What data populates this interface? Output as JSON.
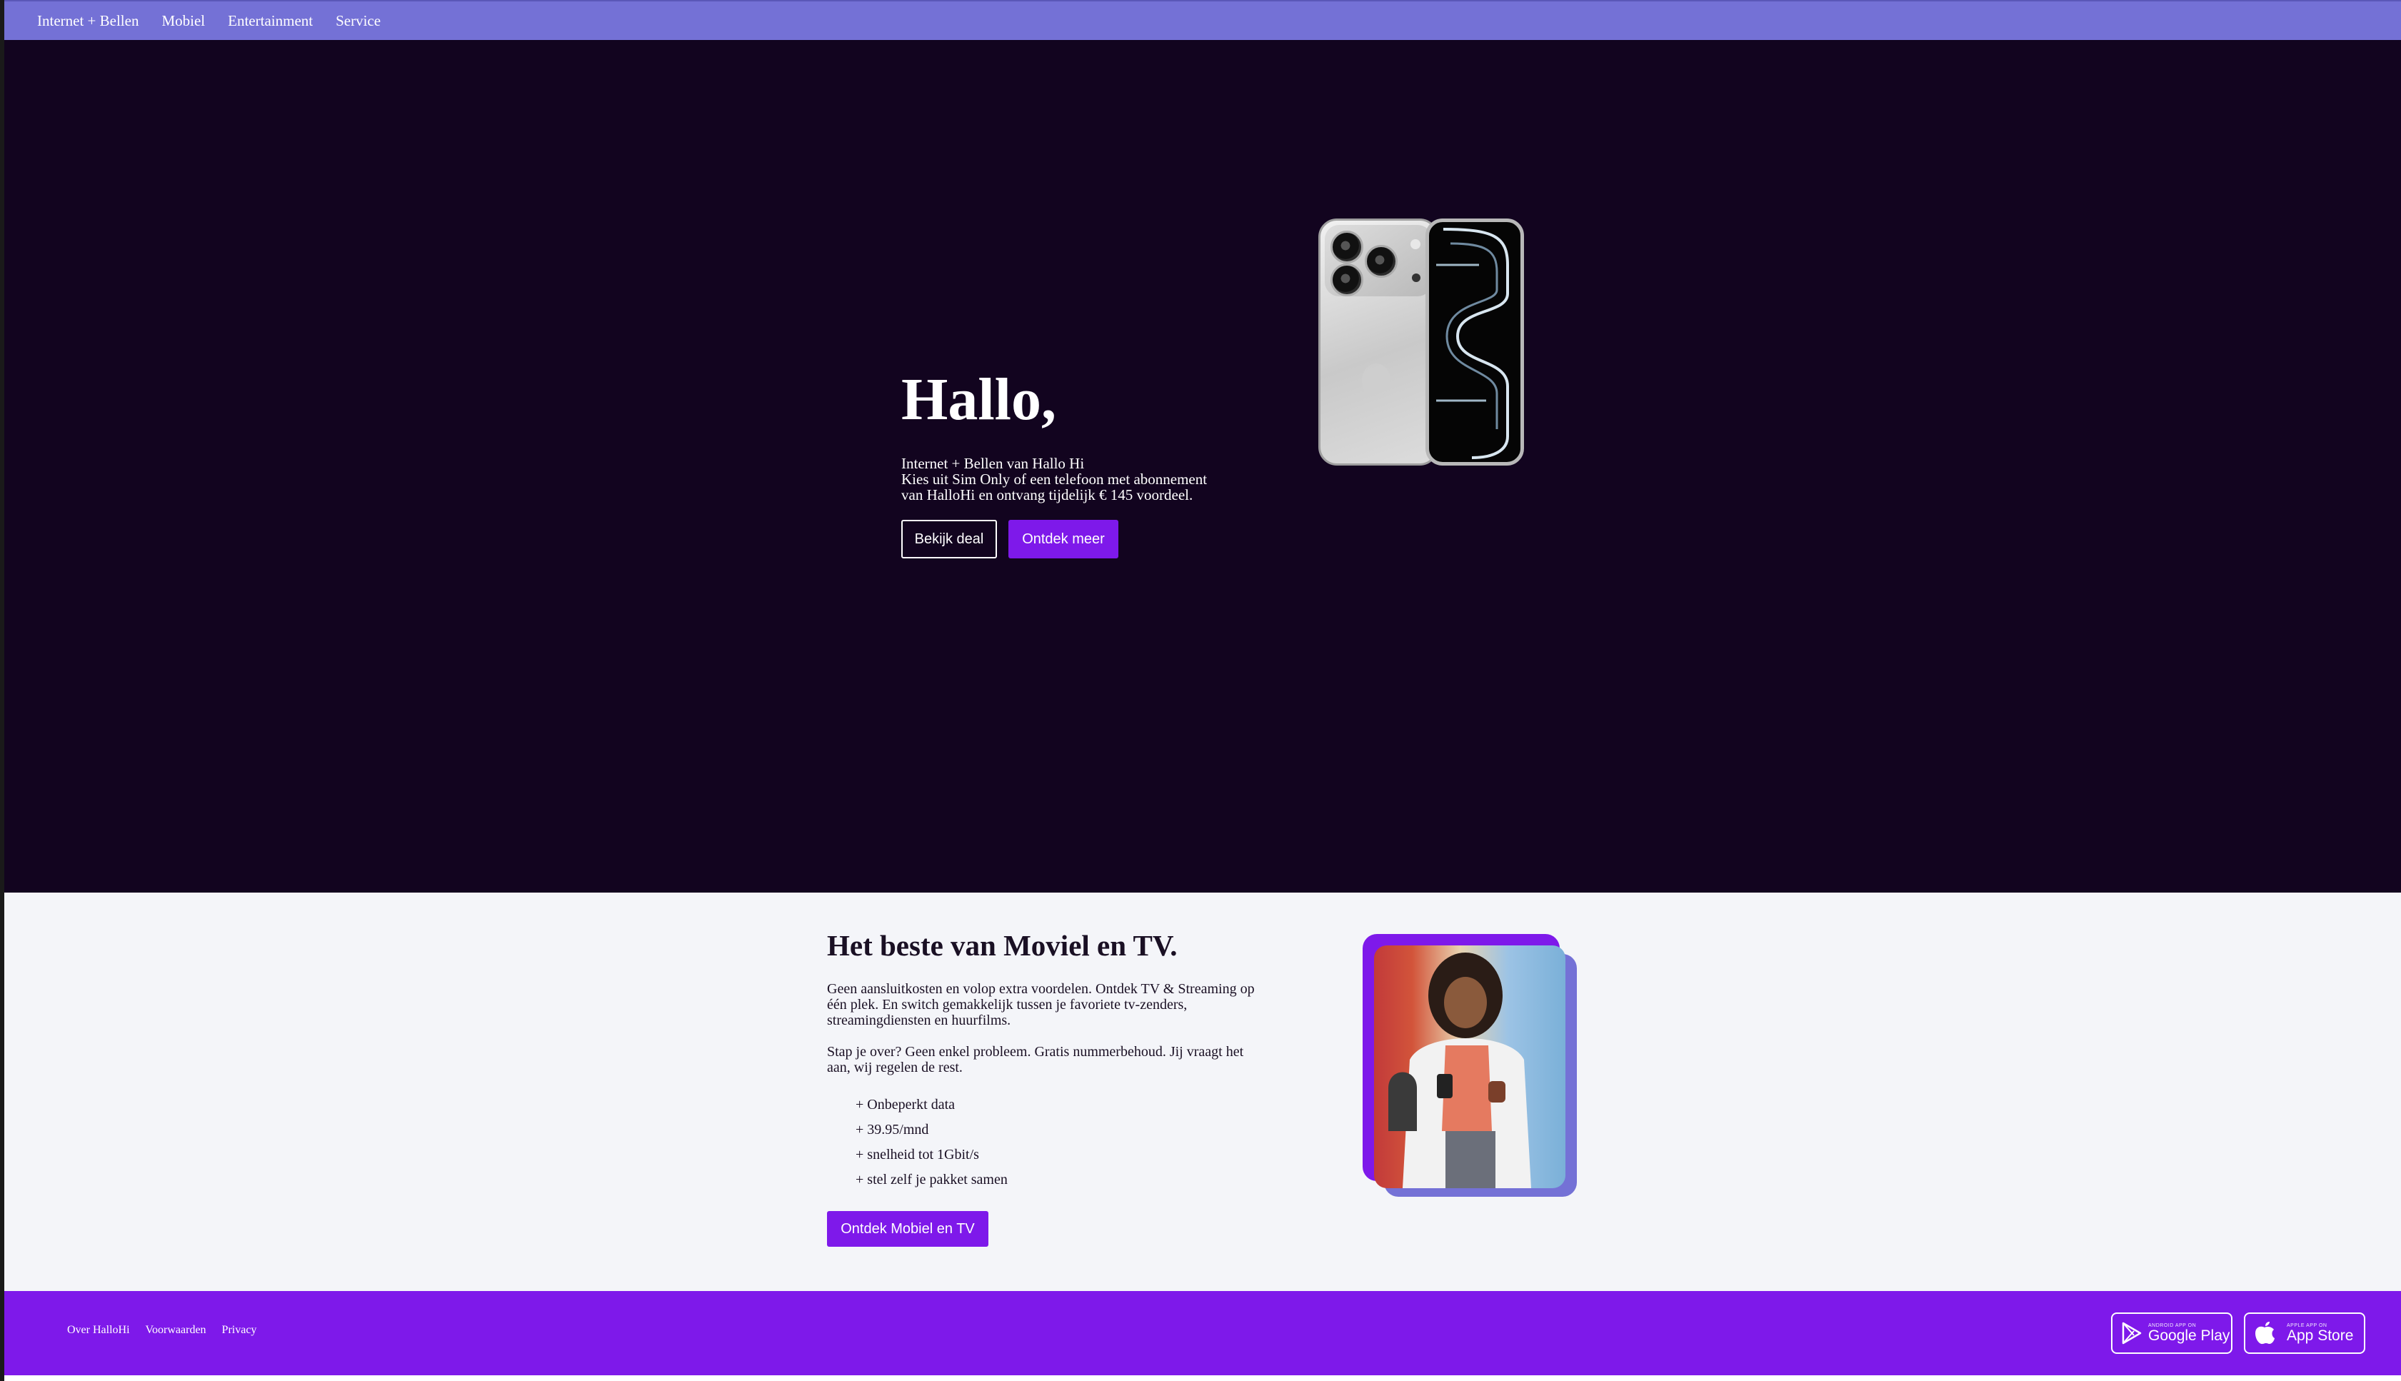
{
  "nav": {
    "items": [
      "Internet + Bellen",
      "Mobiel",
      "Entertainment",
      "Service"
    ]
  },
  "hero": {
    "title": "Hallo,",
    "lines": [
      "Internet + Bellen van Hallo Hi",
      "Kies uit Sim Only of een telefoon met abonnement",
      "van HalloHi en ontvang tijdelijk € 145 voordeel."
    ],
    "deal_button": "Bekijk deal",
    "discover_button": "Ontdek meer"
  },
  "section2": {
    "title": "Het beste van Moviel en TV.",
    "para1": "Geen aansluitkosten en volop extra voordelen. Ontdek TV & Streaming op één plek. En switch gemakkelijk tussen je favoriete tv-zenders, streamingdiensten en huurfilms.",
    "para2": "Stap je over? Geen enkel probleem. Gratis nummerbehoud. Jij vraagt het aan, wij regelen de rest.",
    "features": [
      "+ Onbeperkt data",
      "+ 39.95/mnd",
      "+ snelheid tot 1Gbit/s",
      "+ stel zelf je pakket samen"
    ],
    "button": "Ontdek Mobiel en TV"
  },
  "footer": {
    "links": [
      "Over HalloHi",
      "Voorwaarden",
      "Privacy"
    ],
    "google_play": {
      "small": "ANDROID APP ON",
      "big": "Google Play"
    },
    "app_store": {
      "small": "APPLE APP ON",
      "big": "App Store"
    }
  },
  "colors": {
    "nav": "#7471d6",
    "hero_bg": "#12041f",
    "accent": "#7e19ea",
    "section_bg": "#f4f5f9"
  }
}
